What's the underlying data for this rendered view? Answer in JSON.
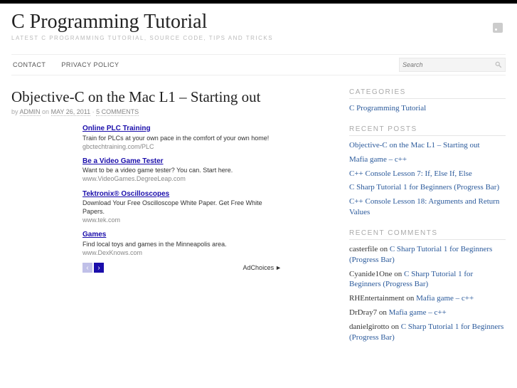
{
  "header": {
    "title": "C Programming Tutorial",
    "subtitle": "LATEST C PROGRAMMING TUTORIAL, SOURCE CODE, TIPS AND TRICKS"
  },
  "nav": {
    "items": [
      "CONTACT",
      "PRIVACY POLICY"
    ]
  },
  "search": {
    "placeholder": "Search"
  },
  "post": {
    "title": "Objective-C on the Mac L1 – Starting out",
    "by": "by",
    "author": "ADMIN",
    "on": "on",
    "date": "MAY 26, 2011",
    "sep": "·",
    "comments": "5 COMMENTS"
  },
  "ads": {
    "items": [
      {
        "title": "Online PLC Training",
        "desc": "Train for PLCs at your own pace in the comfort of your own home!",
        "url": "gbctechtraining.com/PLC"
      },
      {
        "title": "Be a Video Game Tester",
        "desc": "Want to be a video game tester? You can. Start here.",
        "url": "www.VideoGames.DegreeLeap.com"
      },
      {
        "title": "Tektronix® Oscilloscopes",
        "desc": "Download Your Free Oscilloscope White Paper. Get Free White Papers.",
        "url": "www.tek.com"
      },
      {
        "title": "Games",
        "desc": "Find local toys and games in the Minneapolis area.",
        "url": "www.DexKnows.com"
      }
    ],
    "adchoices": "AdChoices"
  },
  "sidebar": {
    "categories": {
      "title": "CATEGORIES",
      "items": [
        "C Programming Tutorial"
      ]
    },
    "recent_posts": {
      "title": "RECENT POSTS",
      "items": [
        "Objective-C on the Mac L1 – Starting out",
        "Mafia game – c++",
        "C++ Console Lesson 7: If, Else If, Else",
        "C Sharp Tutorial 1 for Beginners (Progress Bar)",
        "C++ Console Lesson 18: Arguments and Return Values"
      ]
    },
    "recent_comments": {
      "title": "RECENT COMMENTS",
      "items": [
        {
          "author": "casterfile",
          "on": "on",
          "post": "C Sharp Tutorial 1 for Beginners (Progress Bar)"
        },
        {
          "author": "Cyanide1One",
          "on": "on",
          "post": "C Sharp Tutorial 1 for Beginners (Progress Bar)"
        },
        {
          "author": "RHEntertainment",
          "on": "on",
          "post": "Mafia game – c++"
        },
        {
          "author": "DrDray7",
          "on": "on",
          "post": "Mafia game – c++"
        },
        {
          "author": "danielgirotto",
          "on": "on",
          "post": "C Sharp Tutorial 1 for Beginners (Progress Bar)"
        }
      ]
    }
  }
}
